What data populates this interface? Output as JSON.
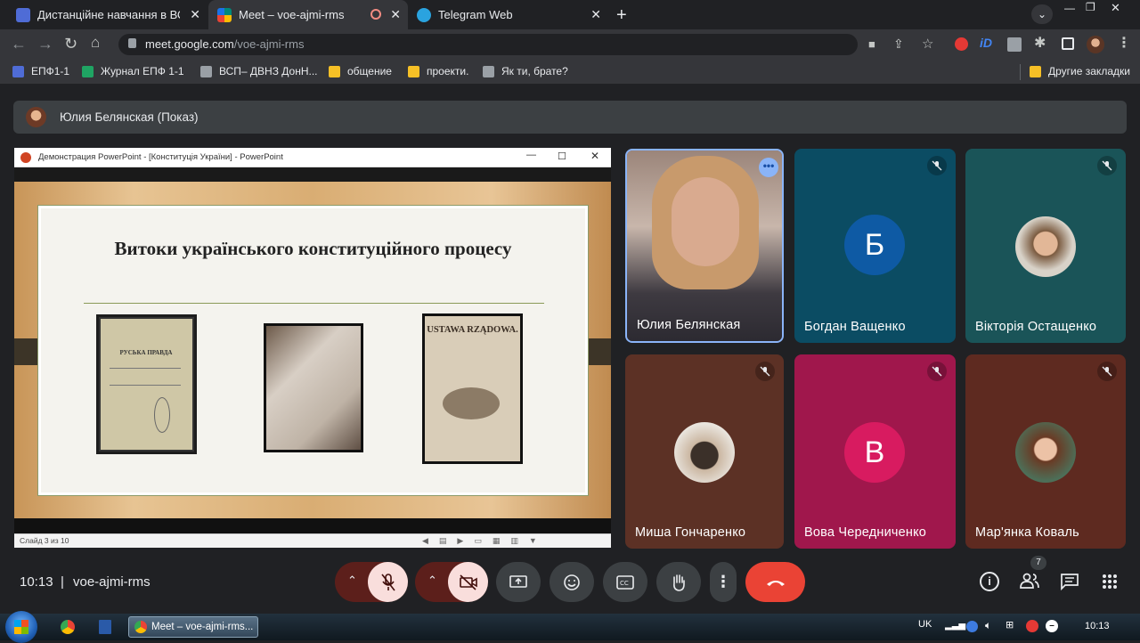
{
  "browser": {
    "tabs": [
      {
        "title": "Дистанційне навчання в ВСП",
        "favicon": "#4f6cd6",
        "active": false
      },
      {
        "title": "Meet – voe-ajmi-rms",
        "favicon": "#00897b",
        "active": true
      },
      {
        "title": "Telegram Web",
        "favicon": "#2aa3df",
        "active": false
      }
    ],
    "new_tab_label": "+",
    "url_host": "meet.google.com",
    "url_path": "/voe-ajmi-rms",
    "bookmarks": [
      {
        "label": "ЕПФ1-1",
        "color": "#4f6cd6"
      },
      {
        "label": "Журнал ЕПФ 1-1",
        "color": "#1fa463"
      },
      {
        "label": "ВСП– ДВНЗ ДонН...",
        "color": "#9aa0a6"
      },
      {
        "label": "общение",
        "color": "#f6c026"
      },
      {
        "label": "проекти.",
        "color": "#f6c026"
      },
      {
        "label": "Як ти, брате?",
        "color": "#9aa0a6"
      }
    ],
    "other_bookmarks": "Другие закладки"
  },
  "meet": {
    "presenter_label": "Юлия Белянская (Показ)",
    "slide_window": {
      "title": "Демонстрация PowerPoint - [Конституція України] - PowerPoint",
      "slide_heading": "Витоки українського конституційного процесу",
      "status": "Слайд 3 из 10",
      "doc1_text": "РУСЬКА ПРАВДА",
      "doc3_title": "USTAWA RZĄDOWA."
    },
    "participants": [
      {
        "name": "Юлия Белянская",
        "type": "video",
        "muted": false
      },
      {
        "name": "Богдан Ващенко",
        "type": "letter",
        "letter": "Б",
        "bg": "#0b4c63",
        "avatar": "#0e5aa4",
        "muted": true
      },
      {
        "name": "Вікторія Остащенко",
        "type": "photo",
        "bg": "#1a5458",
        "muted": true
      },
      {
        "name": "Миша Гончаренко",
        "type": "photo",
        "bg": "#5c3125",
        "muted": true
      },
      {
        "name": "Вова Чередниченко",
        "type": "letter",
        "letter": "В",
        "bg": "#a0174c",
        "avatar": "#d81b60",
        "muted": true
      },
      {
        "name": "Мар'янка Коваль",
        "type": "photo",
        "bg": "#5e2a20",
        "muted": true
      }
    ],
    "clock": "10:13",
    "separator": "|",
    "meeting_code": "voe-ajmi-rms",
    "people_count": "7",
    "end_call_color": "#ea4335"
  },
  "taskbar": {
    "active_window": "Meet – voe-ajmi-rms...",
    "lang": "UK",
    "time": "10:13"
  }
}
